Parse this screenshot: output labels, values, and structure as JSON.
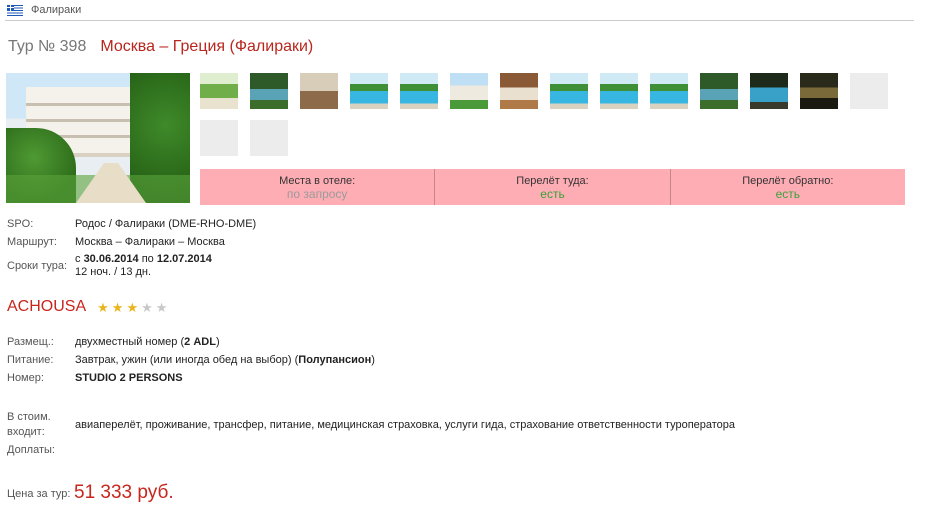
{
  "breadcrumb": {
    "label": "Фалираки"
  },
  "tour": {
    "number_label": "Тур № 398",
    "route": "Москва – Греция (Фалираки)"
  },
  "availability": [
    {
      "label": "Места в отеле:",
      "value": "по запросу",
      "color": "#9a9a9a"
    },
    {
      "label": "Перелёт туда:",
      "value": "есть",
      "color": "#3aa13a"
    },
    {
      "label": "Перелёт обратно:",
      "value": "есть",
      "color": "#3aa13a"
    }
  ],
  "details": {
    "spo_label": "SPO:",
    "spo_value": "Родос / Фалираки (DME-RHO-DME)",
    "route_label": "Маршрут:",
    "route_value": "Москва – Фалираки – Москва",
    "dates_label": "Сроки тура:",
    "dates_from_prefix": "с",
    "dates_from": "30.06.2014",
    "dates_to_prefix": "по",
    "dates_to": "12.07.2014",
    "duration": "12 ноч. / 13 дн."
  },
  "hotel": {
    "name": "ACHOUSA",
    "stars_filled": 3,
    "stars_total": 5
  },
  "room": {
    "placement_label": "Размещ.:",
    "placement_value": "двухместный номер",
    "placement_code": "2 ADL",
    "meal_label": "Питание:",
    "meal_value": "Завтрак, ужин (или иногда обед на выбор)",
    "meal_code": "Полупансион",
    "number_label": "Номер:",
    "number_value": "STUDIO 2 PERSONS"
  },
  "included": {
    "label_line1": "В стоим.",
    "label_line2": "входит:",
    "value": "авиаперелёт, проживание, трансфер, питание, медицинская страховка, услуги гида, страхование ответственности туроператора",
    "extra_label": "Доплаты:"
  },
  "price": {
    "label": "Цена за тур:",
    "value": "51 333 руб."
  },
  "thumbnails": [
    {
      "kind": "garden"
    },
    {
      "kind": "pool-green"
    },
    {
      "kind": "room"
    },
    {
      "kind": "pool"
    },
    {
      "kind": "pool"
    },
    {
      "kind": "building"
    },
    {
      "kind": "bedroom"
    },
    {
      "kind": "pool"
    },
    {
      "kind": "pool"
    },
    {
      "kind": "pool"
    },
    {
      "kind": "pool-green"
    },
    {
      "kind": "pool-night"
    },
    {
      "kind": "night"
    },
    {
      "kind": "empty"
    },
    {
      "kind": "empty"
    },
    {
      "kind": "empty"
    }
  ],
  "colors": {
    "accent_red": "#c7261d",
    "info_bar_bg": "#ffadb5",
    "star_gold": "#e9b51a",
    "star_empty": "#c8c8c8"
  }
}
